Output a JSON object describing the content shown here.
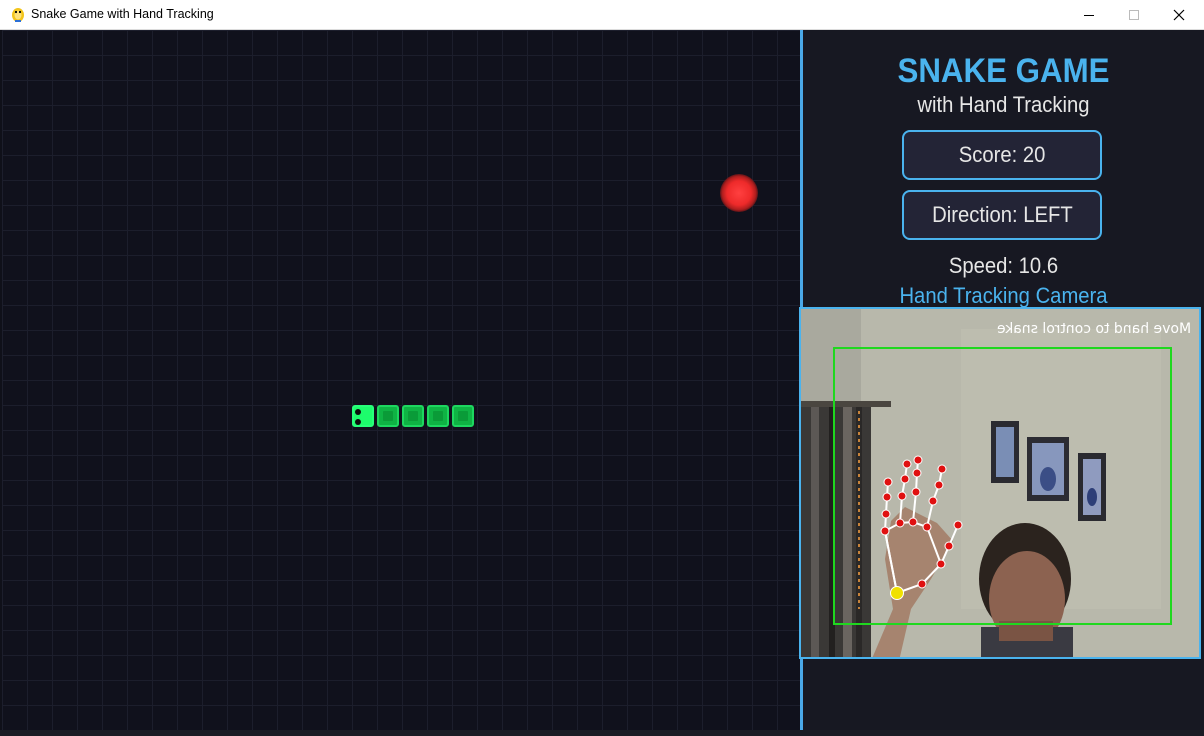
{
  "window": {
    "title": "Snake Game with Hand Tracking",
    "app_icon": "pygame-snake-icon",
    "controls": [
      "minimize",
      "maximize",
      "close"
    ]
  },
  "game": {
    "snake_color": "#1dd75f",
    "food_color": "#ee2a2a",
    "grid_color": "#1c1e2c",
    "background": "#10111c"
  },
  "panel": {
    "title": "SNAKE GAME",
    "subtitle": "with Hand Tracking",
    "score_label": "Score: 20",
    "direction_label": "Direction: LEFT",
    "speed_label": "Speed: 10.6",
    "camera_label": "Hand Tracking Camera",
    "accent_color": "#4ab3ee"
  },
  "camera": {
    "overlay_message": "Move hand to control snake",
    "box_color": "#1fd81f",
    "landmark_color": "#e01010",
    "wrist_color": "#f0e000"
  }
}
